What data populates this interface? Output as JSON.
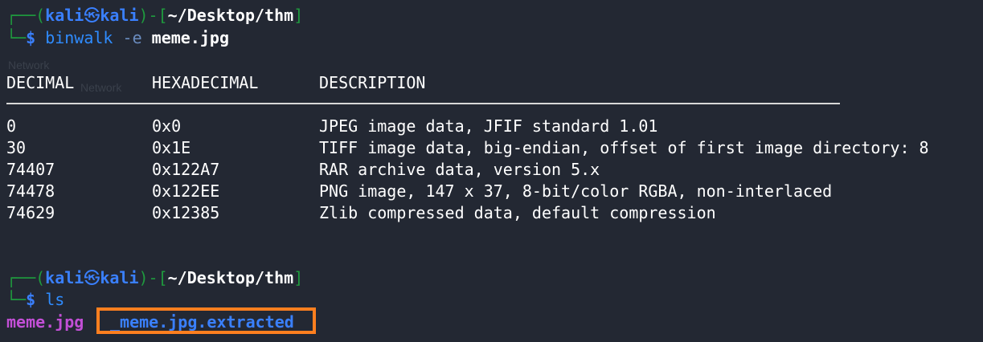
{
  "prompt1": {
    "box_top": "┌──(",
    "user": "kali",
    "host_sep": "㉿",
    "host": "kali",
    "mid": ")-[",
    "path": "~/Desktop/thm",
    "end": "]",
    "box_bottom": "└─",
    "dollar": "$",
    "command": "binwalk",
    "flag": "-e",
    "file": "meme.jpg"
  },
  "table": {
    "headers": [
      "DECIMAL",
      "HEXADECIMAL",
      "DESCRIPTION"
    ],
    "rows": [
      {
        "decimal": "0",
        "hex": "0x0",
        "description": "JPEG image data, JFIF standard 1.01"
      },
      {
        "decimal": "30",
        "hex": "0x1E",
        "description": "TIFF image data, big-endian, offset of first image directory: 8"
      },
      {
        "decimal": "74407",
        "hex": "0x122A7",
        "description": "RAR archive data, version 5.x"
      },
      {
        "decimal": "74478",
        "hex": "0x122EE",
        "description": "PNG image, 147 x 37, 8-bit/color RGBA, non-interlaced"
      },
      {
        "decimal": "74629",
        "hex": "0x12385",
        "description": "Zlib compressed data, default compression"
      }
    ]
  },
  "prompt2": {
    "box_top": "┌──(",
    "user": "kali",
    "host_sep": "㉿",
    "host": "kali",
    "mid": ")-[",
    "path": "~/Desktop/thm",
    "end": "]",
    "box_bottom": "└─",
    "dollar": "$",
    "command": "ls"
  },
  "ls_output": {
    "file": "meme.jpg",
    "directory": "_meme.jpg.extracted"
  },
  "background_ghost": {
    "label1": "Network",
    "label2": "Network"
  },
  "colors": {
    "background": "#232833",
    "prompt_box": "#1f9a3e",
    "prompt_user": "#3a80ff",
    "ls_file": "#c24fd6",
    "ls_dir": "#3a80ff",
    "highlight": "#ff7f1f"
  }
}
